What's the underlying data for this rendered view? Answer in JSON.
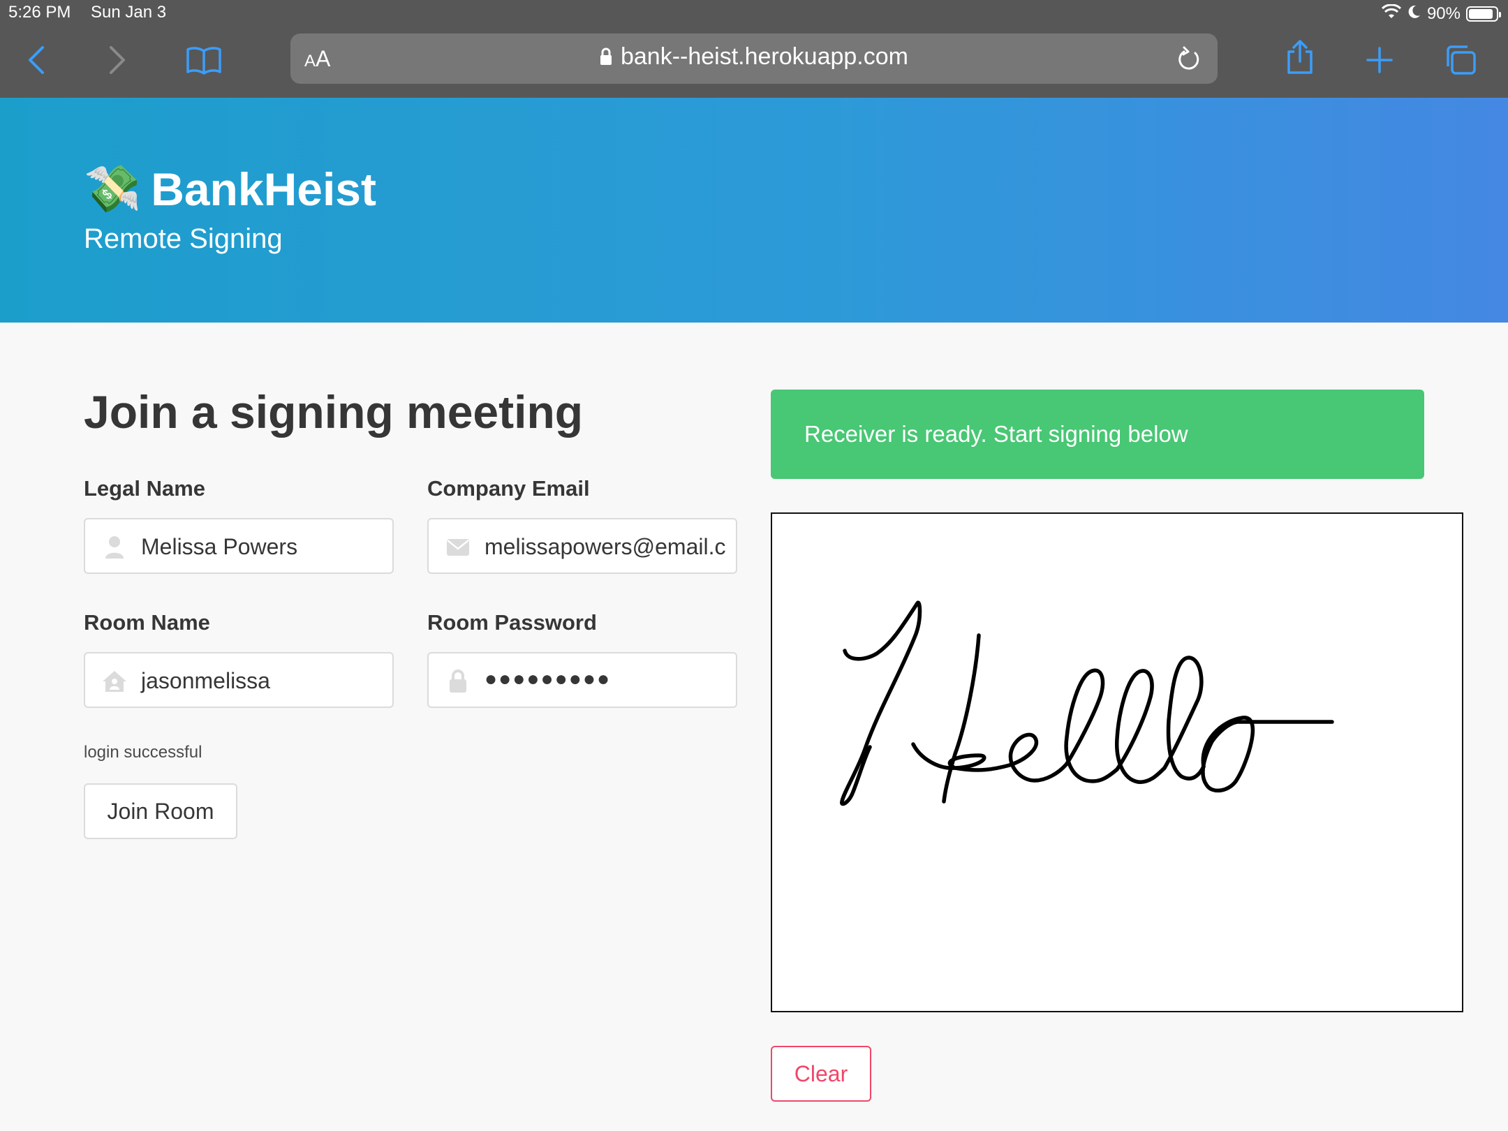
{
  "status_bar": {
    "time": "5:26 PM",
    "date": "Sun Jan 3",
    "battery": "90%",
    "battery_level": 0.9
  },
  "browser": {
    "aa_small": "A",
    "aa_large": "A",
    "url": "bank--heist.herokuapp.com",
    "icons": [
      "back-icon",
      "forward-icon",
      "bookmarks-icon",
      "lock-icon",
      "reload-icon",
      "share-icon",
      "new-tab-icon",
      "tabs-icon"
    ]
  },
  "hero": {
    "brand": "BankHeist",
    "brand_emoji": "💸",
    "tagline": "Remote Signing"
  },
  "form": {
    "heading": "Join a signing meeting",
    "legal_name": {
      "label": "Legal Name",
      "value": "Melissa Powers",
      "icon": "user-icon"
    },
    "company_email": {
      "label": "Company Email",
      "value": "melissapowers@email.c",
      "icon": "envelope-icon"
    },
    "room_name": {
      "label": "Room Name",
      "value": "jasonmelissa",
      "icon": "house-user-icon"
    },
    "room_password": {
      "label": "Room Password",
      "value": "●●●●●●●●●",
      "icon": "lock-icon"
    },
    "status_message": "login successful",
    "join_button": "Join Room"
  },
  "signing": {
    "notice": "Receiver is ready. Start signing below",
    "clear_button": "Clear",
    "colors": {
      "notice_bg": "#48c774",
      "clear": "#f14668"
    }
  }
}
